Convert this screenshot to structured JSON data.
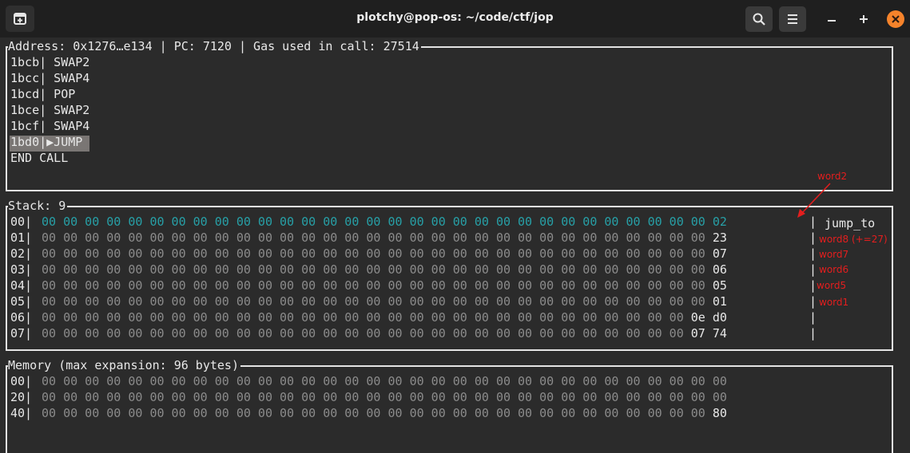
{
  "titlebar": {
    "title": "plotchy@pop-os: ~/code/ctf/jop"
  },
  "icons": {
    "new_tab": "new-tab-icon",
    "search": "search-icon",
    "menu": "hamburger-menu-icon",
    "minimize": "minimize-icon",
    "maximize": "maximize-icon",
    "close": "close-icon"
  },
  "code_panel": {
    "header": "Address: 0x1276…e134 | PC: 7120 | Gas used in call: 27514",
    "lines": [
      "1bcb| SWAP2",
      "1bcc| SWAP4",
      "1bcd| POP",
      "1bce| SWAP2",
      "1bcf| SWAP4"
    ],
    "current_line": "1bd0|▶JUMP",
    "end": "END CALL"
  },
  "stack_panel": {
    "header": "Stack: 9",
    "rows": [
      {
        "addr": "00|",
        "zeros": "00 00 00 00 00 00 00 00 00 00 00 00 00 00 00 00 00 00 00 00 00 00 00 00 00 00 00 00 00 00 00 ",
        "value": "02",
        "sep": "|"
      },
      {
        "addr": "01|",
        "zeros": "00 00 00 00 00 00 00 00 00 00 00 00 00 00 00 00 00 00 00 00 00 00 00 00 00 00 00 00 00 00 00 ",
        "value": "23",
        "sep": "|"
      },
      {
        "addr": "02|",
        "zeros": "00 00 00 00 00 00 00 00 00 00 00 00 00 00 00 00 00 00 00 00 00 00 00 00 00 00 00 00 00 00 00 ",
        "value": "07",
        "sep": "|"
      },
      {
        "addr": "03|",
        "zeros": "00 00 00 00 00 00 00 00 00 00 00 00 00 00 00 00 00 00 00 00 00 00 00 00 00 00 00 00 00 00 00 ",
        "value": "06",
        "sep": "|"
      },
      {
        "addr": "04|",
        "zeros": "00 00 00 00 00 00 00 00 00 00 00 00 00 00 00 00 00 00 00 00 00 00 00 00 00 00 00 00 00 00 00 ",
        "value": "05",
        "sep": "|"
      },
      {
        "addr": "05|",
        "zeros": "00 00 00 00 00 00 00 00 00 00 00 00 00 00 00 00 00 00 00 00 00 00 00 00 00 00 00 00 00 00 00 ",
        "value": "01",
        "sep": "|"
      },
      {
        "addr": "06|",
        "zeros": "00 00 00 00 00 00 00 00 00 00 00 00 00 00 00 00 00 00 00 00 00 00 00 00 00 00 00 00 00 00 ",
        "value": "0e d0",
        "sep": "|"
      },
      {
        "addr": "07|",
        "zeros": "00 00 00 00 00 00 00 00 00 00 00 00 00 00 00 00 00 00 00 00 00 00 00 00 00 00 00 00 00 00 ",
        "value": "07 74",
        "sep": "|"
      }
    ],
    "jump_to_label": "jump_to",
    "annotations": {
      "word2": "word2",
      "word8": "word8 (+=27)",
      "word7": "word7",
      "word6": "word6",
      "word5": "word5",
      "word1": "word1"
    },
    "annotation_color": "#e41e1e"
  },
  "memory_panel": {
    "header": "Memory (max expansion: 96 bytes)",
    "rows": [
      {
        "addr": "00|",
        "zeros": "00 00 00 00 00 00 00 00 00 00 00 00 00 00 00 00 00 00 00 00 00 00 00 00 00 00 00 00 00 00 00 00",
        "value": ""
      },
      {
        "addr": "20|",
        "zeros": "00 00 00 00 00 00 00 00 00 00 00 00 00 00 00 00 00 00 00 00 00 00 00 00 00 00 00 00 00 00 00 00",
        "value": ""
      },
      {
        "addr": "40|",
        "zeros": "00 00 00 00 00 00 00 00 00 00 00 00 00 00 00 00 00 00 00 00 00 00 00 00 00 00 00 00 00 00 00 ",
        "value": "80"
      }
    ]
  },
  "colors": {
    "background": "#2b2b2b",
    "titlebar": "#1f1f1f",
    "teal": "#27a0a7",
    "dim": "#8b8b8b",
    "close": "#f5832b"
  }
}
